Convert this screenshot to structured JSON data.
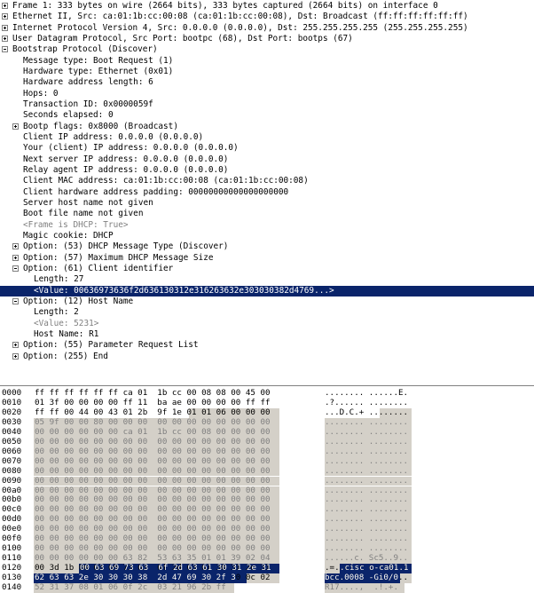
{
  "packet_tree": [
    {
      "text": "Frame 1: 333 bytes on wire (2664 bits), 333 bytes captured (2664 bits) on interface 0",
      "indent": 0,
      "exp": "plus"
    },
    {
      "text": "Ethernet II, Src: ca:01:1b:cc:00:08 (ca:01:1b:cc:00:08), Dst: Broadcast (ff:ff:ff:ff:ff:ff)",
      "indent": 0,
      "exp": "plus"
    },
    {
      "text": "Internet Protocol Version 4, Src: 0.0.0.0 (0.0.0.0), Dst: 255.255.255.255 (255.255.255.255)",
      "indent": 0,
      "exp": "plus"
    },
    {
      "text": "User Datagram Protocol, Src Port: bootpc (68), Dst Port: bootps (67)",
      "indent": 0,
      "exp": "plus"
    },
    {
      "text": "Bootstrap Protocol (Discover)",
      "indent": 0,
      "exp": "minus"
    },
    {
      "text": "Message type: Boot Request (1)",
      "indent": 1
    },
    {
      "text": "Hardware type: Ethernet (0x01)",
      "indent": 1
    },
    {
      "text": "Hardware address length: 6",
      "indent": 1
    },
    {
      "text": "Hops: 0",
      "indent": 1
    },
    {
      "text": "Transaction ID: 0x0000059f",
      "indent": 1
    },
    {
      "text": "Seconds elapsed: 0",
      "indent": 1
    },
    {
      "text": "Bootp flags: 0x8000 (Broadcast)",
      "indent": 1,
      "exp": "plus"
    },
    {
      "text": "Client IP address: 0.0.0.0 (0.0.0.0)",
      "indent": 1
    },
    {
      "text": "Your (client) IP address: 0.0.0.0 (0.0.0.0)",
      "indent": 1
    },
    {
      "text": "Next server IP address: 0.0.0.0 (0.0.0.0)",
      "indent": 1
    },
    {
      "text": "Relay agent IP address: 0.0.0.0 (0.0.0.0)",
      "indent": 1
    },
    {
      "text": "Client MAC address: ca:01:1b:cc:00:08 (ca:01:1b:cc:00:08)",
      "indent": 1
    },
    {
      "text": "Client hardware address padding: 00000000000000000000",
      "indent": 1
    },
    {
      "text": "Server host name not given",
      "indent": 1
    },
    {
      "text": "Boot file name not given",
      "indent": 1
    },
    {
      "text": "<Frame is DHCP: True>",
      "indent": 1,
      "grey": true
    },
    {
      "text": "Magic cookie: DHCP",
      "indent": 1
    },
    {
      "text": "Option: (53) DHCP Message Type (Discover)",
      "indent": 1,
      "exp": "plus"
    },
    {
      "text": "Option: (57) Maximum DHCP Message Size",
      "indent": 1,
      "exp": "plus"
    },
    {
      "text": "Option: (61) Client identifier",
      "indent": 1,
      "exp": "minus"
    },
    {
      "text": "Length: 27",
      "indent": 2
    },
    {
      "text": "<Value: 00636973636f2d636130312e316263632e303030382d4769...>",
      "indent": 2,
      "selected": true
    },
    {
      "text": "Option: (12) Host Name",
      "indent": 1,
      "exp": "minus"
    },
    {
      "text": "Length: 2",
      "indent": 2
    },
    {
      "text": "<Value: 5231>",
      "indent": 2,
      "grey": true
    },
    {
      "text": "Host Name: R1",
      "indent": 2
    },
    {
      "text": "Option: (55) Parameter Request List",
      "indent": 1,
      "exp": "plus"
    },
    {
      "text": "Option: (255) End",
      "indent": 1,
      "exp": "plus"
    }
  ],
  "hex_dump": [
    {
      "off": "0000",
      "bytes": "ff ff ff ff ff ff ca 01  1b cc 00 08 08 00 45 00",
      "ascii": "........ ......E."
    },
    {
      "off": "0010",
      "bytes": "01 3f 00 00 00 00 ff 11  ba ae 00 00 00 00 ff ff",
      "ascii": ".?...... ........"
    },
    {
      "off": "0020",
      "bytes": "ff ff 00 44 00 43 01 2b  9f 1e 01 01 06 00 00 00",
      "ascii": "...D.C.+ ........"
    },
    {
      "off": "0030",
      "bytes": "05 9f 00 00 80 00 00 00  00 00 00 00 00 00 00 00",
      "ascii": "........ ........"
    },
    {
      "off": "0040",
      "bytes": "00 00 00 00 00 00 ca 01  1b cc 00 08 00 00 00 00",
      "ascii": "........ ........"
    },
    {
      "off": "0050",
      "bytes": "00 00 00 00 00 00 00 00  00 00 00 00 00 00 00 00",
      "ascii": "........ ........"
    },
    {
      "off": "0060",
      "bytes": "00 00 00 00 00 00 00 00  00 00 00 00 00 00 00 00",
      "ascii": "........ ........"
    },
    {
      "off": "0070",
      "bytes": "00 00 00 00 00 00 00 00  00 00 00 00 00 00 00 00",
      "ascii": "........ ........"
    },
    {
      "off": "0080",
      "bytes": "00 00 00 00 00 00 00 00  00 00 00 00 00 00 00 00",
      "ascii": "........ ........"
    },
    {
      "off": "0090",
      "bytes": "00 00 00 00 00 00 00 00  00 00 00 00 00 00 00 00",
      "ascii": "........ ........"
    },
    {
      "off": "00a0",
      "bytes": "00 00 00 00 00 00 00 00  00 00 00 00 00 00 00 00",
      "ascii": "........ ........"
    },
    {
      "off": "00b0",
      "bytes": "00 00 00 00 00 00 00 00  00 00 00 00 00 00 00 00",
      "ascii": "........ ........"
    },
    {
      "off": "00c0",
      "bytes": "00 00 00 00 00 00 00 00  00 00 00 00 00 00 00 00",
      "ascii": "........ ........"
    },
    {
      "off": "00d0",
      "bytes": "00 00 00 00 00 00 00 00  00 00 00 00 00 00 00 00",
      "ascii": "........ ........"
    },
    {
      "off": "00e0",
      "bytes": "00 00 00 00 00 00 00 00  00 00 00 00 00 00 00 00",
      "ascii": "........ ........"
    },
    {
      "off": "00f0",
      "bytes": "00 00 00 00 00 00 00 00  00 00 00 00 00 00 00 00",
      "ascii": "........ ........"
    },
    {
      "off": "0100",
      "bytes": "00 00 00 00 00 00 00 00  00 00 00 00 00 00 00 00",
      "ascii": "........ ........"
    },
    {
      "off": "0110",
      "bytes": "00 00 00 00 00 00 63 82  53 63 35 01 01 39 02 04",
      "ascii": "......c. Sc5..9.."
    },
    {
      "off": "0120",
      "bytes": "00 3d 1b 00 63 69 73 63  6f 2d 63 61 30 31 2e 31",
      "ascii": ".=..cisc o-ca01.1"
    },
    {
      "off": "0130",
      "bytes": "62 63 63 2e 30 30 30 38  2d 47 69 30 2f 30 0c 02",
      "ascii": "bcc.0008 -Gi0/0.."
    },
    {
      "off": "0140",
      "bytes": "52 31 37 08 01 06 0f 2c  03 21 96 2b ff",
      "ascii": "R17....,  .!.+."
    }
  ],
  "colors": {
    "selection": "#0a246a",
    "grey_highlight": "#d4d0c8",
    "grey_text": "#808080"
  }
}
